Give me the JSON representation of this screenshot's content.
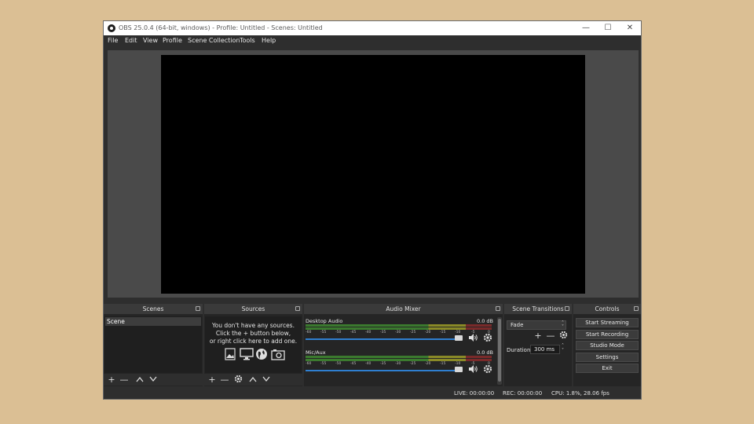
{
  "window": {
    "title": "OBS 25.0.4 (64-bit, windows) - Profile: Untitled - Scenes: Untitled",
    "controls": {
      "minimize": "—",
      "maximize": "☐",
      "close": "✕"
    }
  },
  "menu": [
    "File",
    "Edit",
    "View",
    "Profile",
    "Scene Collection",
    "Tools",
    "Help"
  ],
  "scenes": {
    "title": "Scenes",
    "items": [
      "Scene"
    ]
  },
  "sources": {
    "title": "Sources",
    "empty_line1": "You don't have any sources.",
    "empty_line2": "Click the + button below,",
    "empty_line3": "or right click here to add one."
  },
  "mixer": {
    "title": "Audio Mixer",
    "channels": [
      {
        "name": "Desktop Audio",
        "db": "0.0 dB",
        "volume": 0.98
      },
      {
        "name": "Mic/Aux",
        "db": "0.0 dB",
        "volume": 0.98
      }
    ],
    "ticks": [
      "-60",
      "-55",
      "-50",
      "-45",
      "-40",
      "-35",
      "-30",
      "-25",
      "-20",
      "-15",
      "-10",
      "-5",
      "0"
    ]
  },
  "transitions": {
    "title": "Scene Transitions",
    "selected": "Fade",
    "duration_label": "Duration",
    "duration_value": "300 ms"
  },
  "controls": {
    "title": "Controls",
    "start_streaming": "Start Streaming",
    "start_recording": "Start Recording",
    "studio_mode": "Studio Mode",
    "settings": "Settings",
    "exit": "Exit"
  },
  "status": {
    "live": "LIVE: 00:00:00",
    "rec": "REC: 00:00:00",
    "cpu": "CPU: 1.8%, 28.06 fps"
  },
  "colors": {
    "meter_green": "#3b7a2e",
    "meter_yellow": "#8a8a27",
    "meter_red": "#7a2a2a",
    "volume_blue": "#2f7fd0"
  }
}
